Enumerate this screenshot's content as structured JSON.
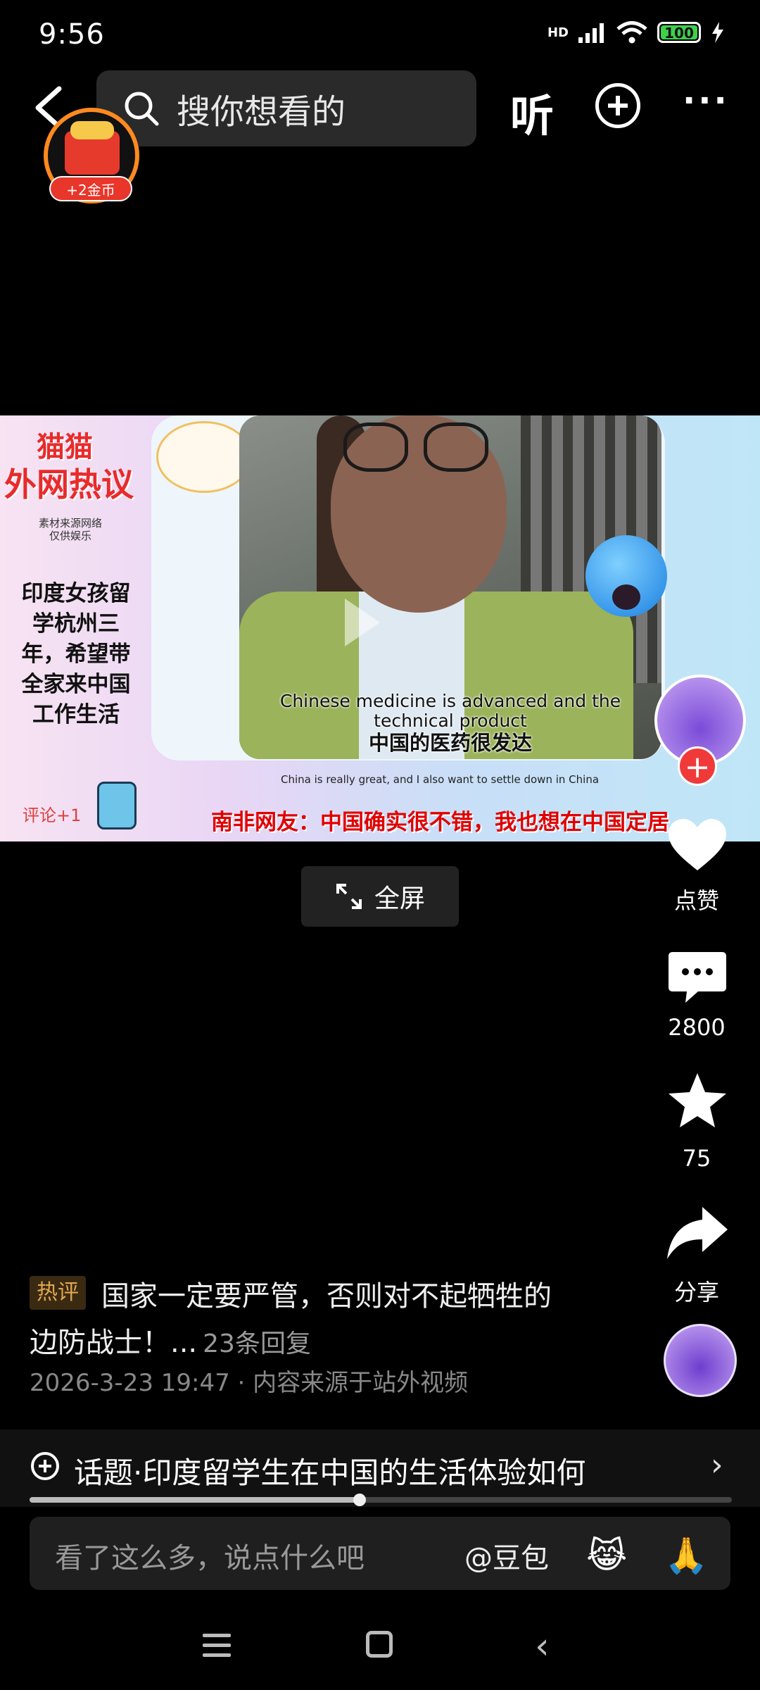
{
  "status_bar": {
    "time": "9:56",
    "network": "HD",
    "battery": "100"
  },
  "top_bar": {
    "search_placeholder": "搜你想看的",
    "listen_label": "听"
  },
  "coin_badge": {
    "label": "+2金币"
  },
  "video": {
    "title_line1": "猫猫",
    "title_line2": "外网热议",
    "source_note_line1": "素材来源网络",
    "source_note_line2": "仅供娱乐",
    "side_text": "印度女孩留学杭州三年，希望带全家来中国工作生活",
    "comment_plus": "评论+1",
    "subtitle_en": "Chinese medicine is advanced and the technical product",
    "subtitle_cn": "中国的医药很发达",
    "caption_small": "China is really great, and I also want to settle down in China",
    "banner": "南非网友：中国确实很不错，我也想在中国定居"
  },
  "fullscreen_label": "全屏",
  "rail": {
    "like_label": "点赞",
    "comment_count": "2800",
    "favorite_count": "75",
    "share_label": "分享"
  },
  "comment": {
    "hot_tag": "热评",
    "line1": "国家一定要严管，否则对不起牺牲的",
    "line2": "边防战士！...",
    "replies": "23条回复",
    "meta": "2026-3-23 19:47 · 内容来源于站外视频"
  },
  "topic": {
    "text": "话题·印度留学生在中国的生活体验如何",
    "progress": 0.47
  },
  "input": {
    "placeholder": "看了这么多，说点什么吧",
    "at_label": "@豆包",
    "emoji1": "😹",
    "emoji2": "🙏"
  },
  "colors": {
    "accent_red": "#e82b2b",
    "hot_tag": "#e0a850",
    "coin_ring": "#ff8a1f",
    "battery": "#3fcf4a"
  }
}
